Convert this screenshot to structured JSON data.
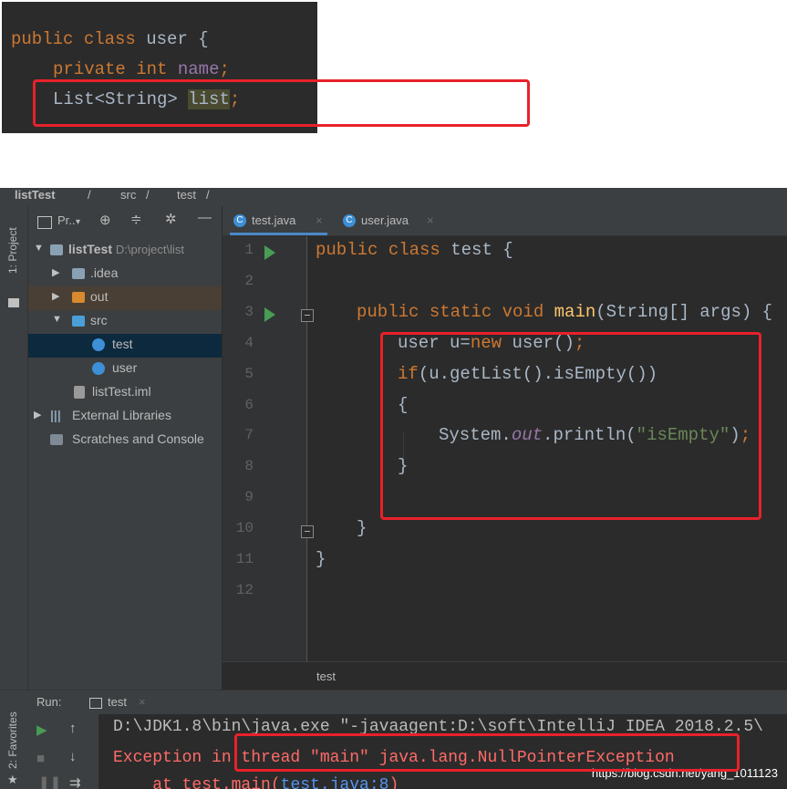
{
  "snippet": {
    "kw_public": "public",
    "kw_class": "class",
    "class_name": "user",
    "brace_open": "{",
    "kw_private": "private",
    "kw_int": "int",
    "field_name": "name",
    "semi": ";",
    "type_list": "List<String>",
    "field_list": "list",
    "semi2": ";"
  },
  "breadcrumb": {
    "project": "listTest",
    "sep1": "/",
    "folder": "src",
    "sep2": "/",
    "file": "test",
    "sep3": "/"
  },
  "tool_strip": {
    "project_tab": "1: Project",
    "favorites_tab": "2: Favorites"
  },
  "project_panel": {
    "title": "Pr..",
    "tree": [
      {
        "label": "listTest",
        "path": "D:\\project\\list"
      },
      {
        "label": ".idea"
      },
      {
        "label": "out"
      },
      {
        "label": "src"
      },
      {
        "label": "test"
      },
      {
        "label": "user"
      },
      {
        "label": "listTest.iml"
      },
      {
        "label": "External Libraries"
      },
      {
        "label": "Scratches and Console"
      }
    ]
  },
  "editor": {
    "tabs": [
      {
        "label": "test.java",
        "icon": "C"
      },
      {
        "label": "user.java",
        "icon": "C"
      }
    ],
    "line_numbers": [
      "1",
      "2",
      "3",
      "4",
      "5",
      "6",
      "7",
      "8",
      "9",
      "10",
      "11",
      "12"
    ],
    "code": {
      "l1_kw": "public class ",
      "l1_name": "test {",
      "l3_kw": "public static void ",
      "l3_meth": "main",
      "l3_rest": "(String[] args) {",
      "l4_a": "user u=",
      "l4_kw": "new",
      "l4_b": " user()",
      "l4_semi": ";",
      "l5_kw": "if",
      "l5_rest": "(u.getList().isEmpty())",
      "l6": "{",
      "l7_a": "System.",
      "l7_out": "out",
      "l7_b": ".println(",
      "l7_str": "\"isEmpty\"",
      "l7_c": ")",
      "l7_semi": ";",
      "l8": "}",
      "l10": "}",
      "l11": "}"
    },
    "footer_crumb": "test"
  },
  "run_panel": {
    "label": "Run:",
    "tab": "test",
    "lines": {
      "cmd": "D:\\JDK1.8\\bin\\java.exe \"-javaagent:D:\\soft\\IntelliJ IDEA 2018.2.5\\",
      "exc": "Exception in thread \"main\" java.lang.NullPointerException",
      "at_a": "    at test.main(",
      "at_link": "test.java:8",
      "at_b": ")"
    }
  },
  "watermark": "https://blog.csdn.net/yang_1011123",
  "colors": {
    "keyword": "#cc7832",
    "field": "#9876aa",
    "method": "#ffc66d",
    "string": "#6a8759",
    "error": "#ff6b68",
    "highlight_box": "#e8212a"
  }
}
